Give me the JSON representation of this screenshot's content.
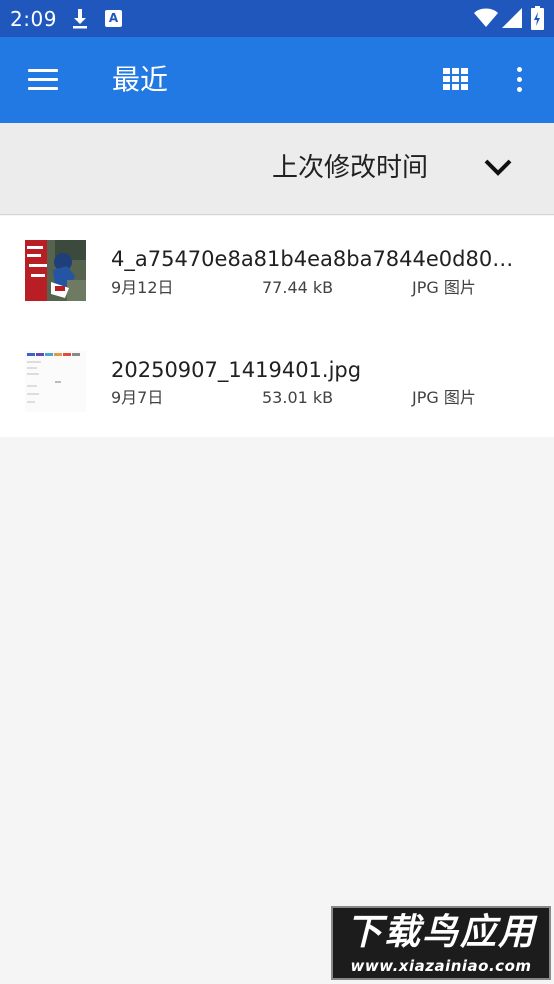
{
  "status_bar": {
    "time": "2:09",
    "icons": [
      "download-icon",
      "a-notification-icon",
      "wifi-icon",
      "signal-icon",
      "battery-icon"
    ]
  },
  "app_bar": {
    "title": "最近",
    "icons": [
      "menu-icon",
      "grid-view-icon",
      "more-options-icon"
    ],
    "color": "#2379e3"
  },
  "sort_bar": {
    "label": "上次修改时间",
    "icon": "chevron-down-icon"
  },
  "files": [
    {
      "name": "4_a75470e8a81b4ea8ba7844e0d80…",
      "date": "9月12日",
      "size": "77.44 kB",
      "type": "JPG 图片",
      "thumbnail": "photo-thumbnail"
    },
    {
      "name": "20250907_1419401.jpg",
      "date": "9月7日",
      "size": "53.01 kB",
      "type": "JPG 图片",
      "thumbnail": "screenshot-thumbnail"
    }
  ],
  "watermark": {
    "title": "下载鸟应用",
    "url": "www.xiazainiao.com"
  },
  "colors": {
    "status_bar": "#1f57bd",
    "app_bar": "#2379e3",
    "sort_bar": "#ececec",
    "background": "#f5f5f5"
  }
}
